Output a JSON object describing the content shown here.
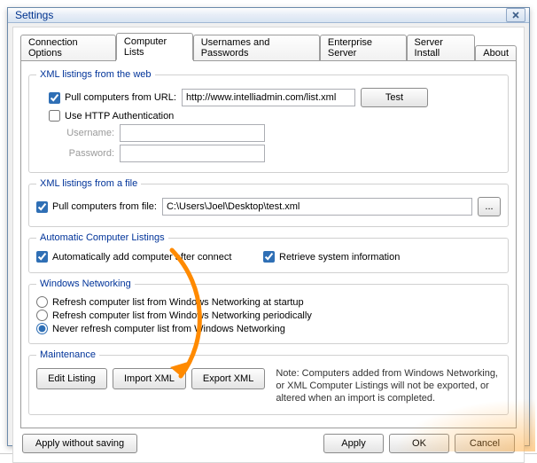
{
  "window": {
    "title": "Settings"
  },
  "tabs": [
    "Connection Options",
    "Computer Lists",
    "Usernames and Passwords",
    "Enterprise Server",
    "Server Install",
    "About"
  ],
  "activeTabIndex": 1,
  "webGroup": {
    "legend": "XML listings from the web",
    "pullFromUrlLabel": "Pull computers from URL:",
    "pullFromUrlChecked": true,
    "urlValue": "http://www.intelliadmin.com/list.xml",
    "testLabel": "Test",
    "httpAuthLabel": "Use HTTP Authentication",
    "httpAuthChecked": false,
    "usernameLabel": "Username:",
    "passwordLabel": "Password:"
  },
  "fileGroup": {
    "legend": "XML listings from a file",
    "pullFromFileLabel": "Pull computers from file:",
    "pullFromFileChecked": true,
    "fileValue": "C:\\Users\\Joel\\Desktop\\test.xml",
    "browseLabel": "..."
  },
  "autoGroup": {
    "legend": "Automatic Computer Listings",
    "autoAddLabel": "Automatically add computer after connect",
    "autoAddChecked": true,
    "retrieveLabel": "Retrieve system information",
    "retrieveChecked": true
  },
  "winNetGroup": {
    "legend": "Windows Networking",
    "options": [
      "Refresh computer list from Windows Networking at startup",
      "Refresh computer list from Windows Networking periodically",
      "Never refresh computer list from Windows Networking"
    ],
    "selectedIndex": 2
  },
  "maintGroup": {
    "legend": "Maintenance",
    "editLabel": "Edit Listing",
    "importLabel": "Import XML",
    "exportLabel": "Export XML",
    "note": "Note: Computers added from Windows Networking, or XML Computer Listings will not be exported, or altered when an import is completed."
  },
  "buttons": {
    "applyNoSave": "Apply without saving",
    "apply": "Apply",
    "ok": "OK",
    "cancel": "Cancel"
  }
}
